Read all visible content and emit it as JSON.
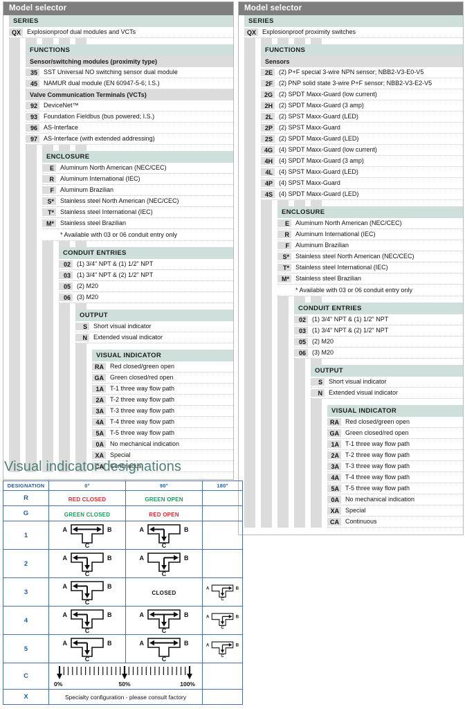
{
  "selector_left": {
    "title": "Model selector",
    "sections": [
      {
        "name": "series",
        "header": "SERIES",
        "level": 0,
        "rows": [
          {
            "code": "QX",
            "desc": "Explosionproof dual modules and VCTs"
          }
        ]
      },
      {
        "name": "functions",
        "header": "FUNCTIONS",
        "level": 1,
        "groups": [
          {
            "subhead": "Sensor/switching modules (proximity type)",
            "rows": [
              {
                "code": "35",
                "desc": "SST Universal NO switching sensor dual module"
              },
              {
                "code": "45",
                "desc": "NAMUR dual module (EN 60947-5-6; I.S.)"
              }
            ]
          },
          {
            "subhead": "Valve Communication Terminals (VCTs)",
            "rows": [
              {
                "code": "92",
                "desc": "DeviceNet™"
              },
              {
                "code": "93",
                "desc": "Foundation Fieldbus (bus powered; I.S.)"
              },
              {
                "code": "96",
                "desc": "AS-Interface"
              },
              {
                "code": "97",
                "desc": "AS-Interface (with extended addressing)"
              }
            ]
          }
        ]
      },
      {
        "name": "enclosure",
        "header": "ENCLOSURE",
        "level": 2,
        "rows": [
          {
            "code": "E",
            "desc": "Aluminum North American (NEC/CEC)"
          },
          {
            "code": "R",
            "desc": "Aluminum International (IEC)"
          },
          {
            "code": "F",
            "desc": "Aluminum Brazilian"
          },
          {
            "code": "S*",
            "desc": "Stainless steel North American (NEC/CEC)"
          },
          {
            "code": "T*",
            "desc": "Stainless steel International (IEC)"
          },
          {
            "code": "M*",
            "desc": "Stainless steel Brazilian"
          }
        ],
        "note": "* Available with 03 or 06 conduit entry only"
      },
      {
        "name": "conduit-entries",
        "header": "CONDUIT ENTRIES",
        "level": 3,
        "rows": [
          {
            "code": "02",
            "desc": "(1) 3/4\" NPT & (1) 1/2\" NPT"
          },
          {
            "code": "03",
            "desc": "(1) 3/4\" NPT & (2) 1/2\" NPT"
          },
          {
            "code": "05",
            "desc": "(2) M20"
          },
          {
            "code": "06",
            "desc": "(3) M20"
          }
        ]
      },
      {
        "name": "output",
        "header": "OUTPUT",
        "level": 4,
        "rows": [
          {
            "code": "S",
            "desc": "Short visual indicator"
          },
          {
            "code": "N",
            "desc": "Extended visual indicator"
          }
        ]
      },
      {
        "name": "visual-indicator",
        "header": "VISUAL INDICATOR",
        "level": 5,
        "rows": [
          {
            "code": "RA",
            "desc": "Red closed/green open"
          },
          {
            "code": "GA",
            "desc": "Green closed/red open"
          },
          {
            "code": "1A",
            "desc": "T-1 three way flow path"
          },
          {
            "code": "2A",
            "desc": "T-2 three way flow path"
          },
          {
            "code": "3A",
            "desc": "T-3 three way flow path"
          },
          {
            "code": "4A",
            "desc": "T-4 three way flow path"
          },
          {
            "code": "5A",
            "desc": "T-5 three way flow path"
          },
          {
            "code": "0A",
            "desc": "No mechanical indication"
          },
          {
            "code": "XA",
            "desc": "Special"
          },
          {
            "code": "CA",
            "desc": "Continuous"
          }
        ]
      }
    ]
  },
  "selector_right": {
    "title": "Model selector",
    "sections": [
      {
        "name": "series",
        "header": "SERIES",
        "level": 0,
        "rows": [
          {
            "code": "QX",
            "desc": "Explosionproof proximity switches"
          }
        ]
      },
      {
        "name": "functions",
        "header": "FUNCTIONS",
        "level": 1,
        "groups": [
          {
            "subhead": "Sensors",
            "rows": [
              {
                "code": "2E",
                "desc": "(2) P+F special 3-wire NPN sensor; NBB2-V3-E0-V5"
              },
              {
                "code": "2F",
                "desc": "(2) PNP solid state 3-wire P+F sensor; NBB2-V3-E2-V5"
              },
              {
                "code": "2G",
                "desc": "(2) SPDT Maxx-Guard (low current)"
              },
              {
                "code": "2H",
                "desc": "(2) SPDT Maxx-Guard (3 amp)"
              },
              {
                "code": "2L",
                "desc": "(2) SPST Maxx-Guard (LED)"
              },
              {
                "code": "2P",
                "desc": "(2) SPST Maxx-Guard"
              },
              {
                "code": "2S",
                "desc": "(2) SPDT Maxx-Guard (LED)"
              },
              {
                "code": "4G",
                "desc": "(4) SPDT Maxx-Guard (low current)"
              },
              {
                "code": "4H",
                "desc": "(4) SPDT Maxx-Guard (3 amp)"
              },
              {
                "code": "4L",
                "desc": "(4) SPST Maxx-Guard (LED)"
              },
              {
                "code": "4P",
                "desc": "(4) SPST Maxx-Guard"
              },
              {
                "code": "4S",
                "desc": "(4) SPDT Maxx-Guard (LED)"
              }
            ]
          }
        ]
      },
      {
        "name": "enclosure",
        "header": "ENCLOSURE",
        "level": 2,
        "rows": [
          {
            "code": "E",
            "desc": "Aluminum North American (NEC/CEC)"
          },
          {
            "code": "R",
            "desc": "Aluminum International (IEC)"
          },
          {
            "code": "F",
            "desc": "Aluminum Brazilian"
          },
          {
            "code": "S*",
            "desc": "Stainless steel North American (NEC/CEC)"
          },
          {
            "code": "T*",
            "desc": "Stainless steel International (IEC)"
          },
          {
            "code": "M*",
            "desc": "Stainless steel Brazilian"
          }
        ],
        "note": "* Available with 03 or 06 conduit entry only"
      },
      {
        "name": "conduit-entries",
        "header": "CONDUIT ENTRIES",
        "level": 3,
        "rows": [
          {
            "code": "02",
            "desc": "(1) 3/4\" NPT & (1) 1/2\" NPT"
          },
          {
            "code": "03",
            "desc": "(1) 3/4\" NPT & (2) 1/2\" NPT"
          },
          {
            "code": "05",
            "desc": "(2) M20"
          },
          {
            "code": "06",
            "desc": "(3) M20"
          }
        ]
      },
      {
        "name": "output",
        "header": "OUTPUT",
        "level": 4,
        "rows": [
          {
            "code": "S",
            "desc": "Short visual indicator"
          },
          {
            "code": "N",
            "desc": "Extended visual indicator"
          }
        ]
      },
      {
        "name": "visual-indicator",
        "header": "VISUAL INDICATOR",
        "level": 5,
        "rows": [
          {
            "code": "RA",
            "desc": "Red closed/green open"
          },
          {
            "code": "GA",
            "desc": "Green closed/red open"
          },
          {
            "code": "1A",
            "desc": "T-1 three way flow path"
          },
          {
            "code": "2A",
            "desc": "T-2 three way flow path"
          },
          {
            "code": "3A",
            "desc": "T-3 three way flow path"
          },
          {
            "code": "4A",
            "desc": "T-4 three way flow path"
          },
          {
            "code": "5A",
            "desc": "T-5 three way flow path"
          },
          {
            "code": "0A",
            "desc": "No mechanical indication"
          },
          {
            "code": "XA",
            "desc": "Special"
          },
          {
            "code": "CA",
            "desc": "Continuous"
          }
        ]
      }
    ]
  },
  "designations": {
    "title": "Visual indicator designations",
    "columns": [
      "DESIGNATION",
      "0°",
      "90°",
      "180°"
    ],
    "port_labels": {
      "a": "A",
      "b": "B",
      "c": "C"
    },
    "gauge": {
      "start": "0%",
      "mid": "50%",
      "end": "100%"
    },
    "closed_label": "CLOSED",
    "rows": [
      {
        "designation": "R",
        "kind": "text",
        "cells": [
          {
            "text": "RED CLOSED",
            "style": "red"
          },
          {
            "text": "GREEN OPEN",
            "style": "green"
          },
          {
            "text": "",
            "style": "none"
          }
        ]
      },
      {
        "designation": "G",
        "kind": "text",
        "cells": [
          {
            "text": "GREEN CLOSED",
            "style": "green"
          },
          {
            "text": "RED OPEN",
            "style": "red"
          },
          {
            "text": "",
            "style": "none"
          }
        ]
      },
      {
        "designation": "1",
        "kind": "diagram",
        "cells": [
          {
            "diagram": "ab-both"
          },
          {
            "diagram": "a-left-c-down"
          },
          {
            "diagram": "empty"
          }
        ]
      },
      {
        "designation": "2",
        "kind": "diagram",
        "cells": [
          {
            "diagram": "a-left-c-down"
          },
          {
            "diagram": "b-right-c-down"
          },
          {
            "diagram": "empty"
          }
        ]
      },
      {
        "designation": "3",
        "kind": "diagram",
        "cells": [
          {
            "diagram": "a-left-c-down"
          },
          {
            "diagram": "closed"
          },
          {
            "diagram": "b-right-c-down"
          }
        ]
      },
      {
        "designation": "4",
        "kind": "diagram",
        "cells": [
          {
            "diagram": "a-left-c-down"
          },
          {
            "diagram": "ab-both-c-down"
          },
          {
            "diagram": "b-right-c-down"
          }
        ]
      },
      {
        "designation": "5",
        "kind": "diagram",
        "cells": [
          {
            "diagram": "a-left-c-down"
          },
          {
            "diagram": "ab-both"
          },
          {
            "diagram": "b-right-c-down"
          }
        ]
      },
      {
        "designation": "C",
        "kind": "gauge",
        "cells": [
          {
            "diagram": "gauge-span2"
          }
        ]
      },
      {
        "designation": "X",
        "kind": "note",
        "cells": [
          {
            "text": "Specialty configuration - please consult factory"
          }
        ]
      }
    ]
  }
}
